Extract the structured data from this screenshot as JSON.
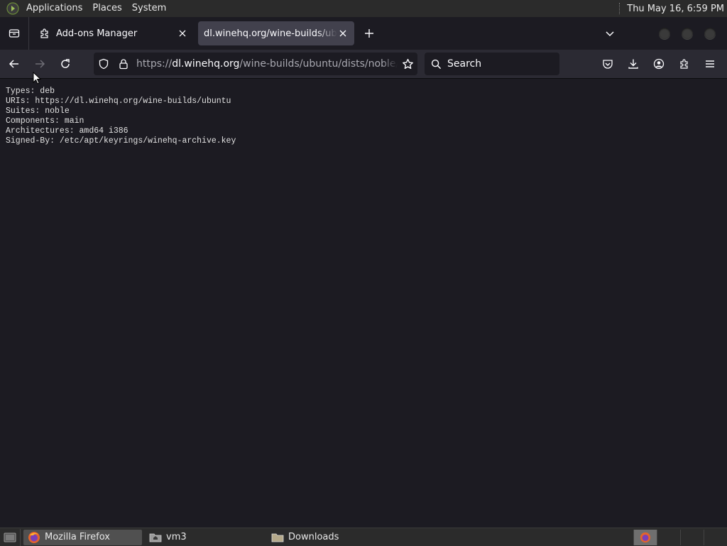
{
  "top_panel": {
    "menus": [
      "Applications",
      "Places",
      "System"
    ],
    "clock": "Thu May 16,  6:59 PM"
  },
  "tabs": [
    {
      "title": "Add-ons Manager",
      "icon": "puzzle-icon",
      "active": false
    },
    {
      "title": "dl.winehq.org/wine-builds/ubuntu",
      "icon": "",
      "active": true
    }
  ],
  "navbar": {
    "url_host": "dl.winehq.org",
    "url_prefix": "https://",
    "url_path": "/wine-builds/ubuntu/dists/noble/winehq-noble.sources",
    "search_placeholder": "Search"
  },
  "content": {
    "lines": [
      "Types: deb",
      "URIs: https://dl.winehq.org/wine-builds/ubuntu",
      "Suites: noble",
      "Components: main",
      "Architectures: amd64 i386",
      "Signed-By: /etc/apt/keyrings/winehq-archive.key"
    ]
  },
  "taskbar": {
    "tasks": [
      {
        "label": "Mozilla Firefox",
        "icon": "firefox-icon",
        "active": true
      },
      {
        "label": "vm3",
        "icon": "folder-home-icon",
        "active": false
      },
      {
        "label": "Downloads",
        "icon": "folder-icon",
        "active": false
      }
    ]
  },
  "colors": {
    "content_bg": "#1c1b22",
    "toolbar_bg": "#2b2a33",
    "active_tab_bg": "#42414d"
  }
}
